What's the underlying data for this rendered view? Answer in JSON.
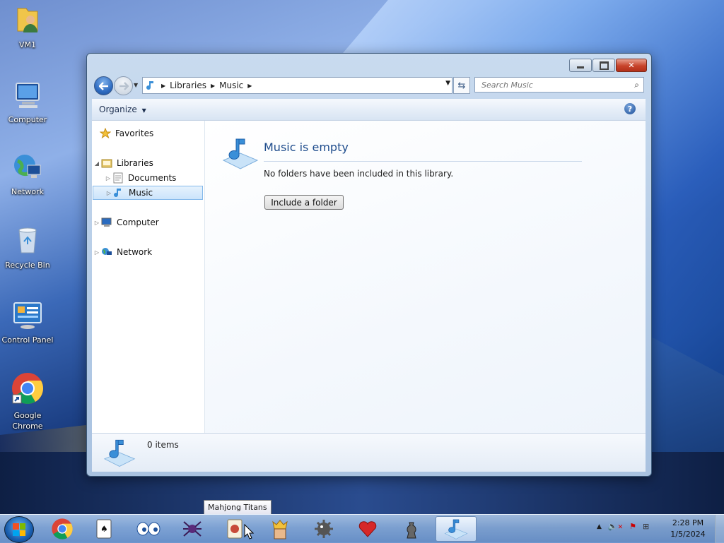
{
  "desktop": {
    "icons": [
      {
        "label": "VM1",
        "icon": "user-folder-icon"
      },
      {
        "label": "Computer",
        "icon": "computer-icon"
      },
      {
        "label": "Network",
        "icon": "network-globe-icon"
      },
      {
        "label": "Recycle Bin",
        "icon": "recycle-bin-icon"
      },
      {
        "label": "Control Panel",
        "icon": "control-panel-icon"
      },
      {
        "label": "Google Chrome",
        "icon": "chrome-icon"
      }
    ]
  },
  "window": {
    "caption_buttons": {
      "minimize": "▭",
      "maximize": "◻",
      "close": "✕"
    },
    "address": {
      "crumbs": [
        "Libraries",
        "Music"
      ]
    },
    "search": {
      "placeholder": "Search Music"
    },
    "toolbar": {
      "organize": "Organize"
    },
    "nav_tree": {
      "favorites": "Favorites",
      "libraries": "Libraries",
      "documents": "Documents",
      "music": "Music",
      "computer": "Computer",
      "network": "Network"
    },
    "content": {
      "title": "Music is empty",
      "description": "No folders have been included in this library.",
      "button": "Include a folder"
    },
    "details": {
      "items": "0 items"
    }
  },
  "taskbar": {
    "tooltip": "Mahjong Titans",
    "apps": [
      "chrome-icon",
      "solitaire-icon",
      "eyes-icon",
      "spider-solitaire-icon",
      "mahjong-icon",
      "freecell-king-icon",
      "minesweeper-icon",
      "hearts-icon",
      "chess-icon",
      "music-library-icon"
    ],
    "clock": {
      "time": "2:28 PM",
      "date": "1/5/2024"
    }
  },
  "colors": {
    "accent": "#1e4c8c",
    "taskbar": "#8cafdc",
    "close": "#c7432a"
  }
}
